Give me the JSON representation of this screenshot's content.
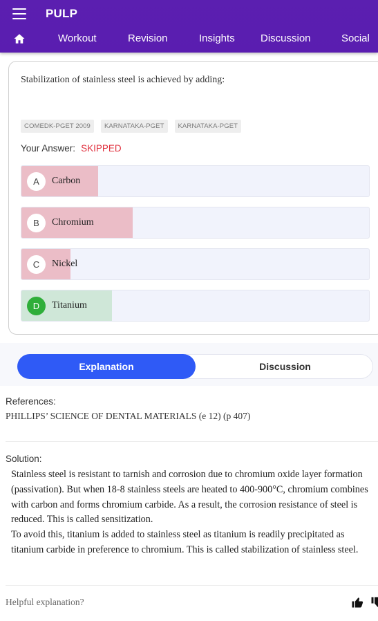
{
  "app": {
    "title": "PULP"
  },
  "nav": {
    "tabs": [
      {
        "label": "Workout"
      },
      {
        "label": "Revision"
      },
      {
        "label": "Insights"
      },
      {
        "label": "Discussion"
      },
      {
        "label": "Social"
      }
    ]
  },
  "question": {
    "text": "Stabilization of stainless steel is achieved by adding:",
    "tags": [
      "COMEDK-PGET 2009",
      "KARNATAKA-PGET",
      "KARNATAKA-PGET"
    ],
    "answer_label": "Your Answer:",
    "answer_status": "SKIPPED",
    "options": [
      {
        "letter": "A",
        "label": "Carbon",
        "correct": false
      },
      {
        "letter": "B",
        "label": "Chromium",
        "correct": false
      },
      {
        "letter": "C",
        "label": "Nickel",
        "correct": false
      },
      {
        "letter": "D",
        "label": "Titanium",
        "correct": true
      }
    ]
  },
  "explanation_tabs": {
    "explanation": "Explanation",
    "discussion": "Discussion"
  },
  "references": {
    "heading": "References:",
    "text": "PHILLIPS’ SCIENCE OF DENTAL MATERIALS (e 12) (p 407)"
  },
  "solution": {
    "heading": "Solution:",
    "paragraphs": [
      "Stainless steel is resistant to tarnish and corrosion due to chromium oxide layer formation (passivation). But when 18-8 stainless steels are heated to 400-900°C, chromium combines with carbon and forms chromium carbide. As a result, the corrosion resistance of steel is reduced. This is called sensitization.",
      "To avoid this, titanium is added to stainless steel as titanium is readily precipitated as titanium carbide in preference to chromium. This is called stabilization of stainless steel."
    ]
  },
  "feedback": {
    "prompt": "Helpful explanation?"
  },
  "colors": {
    "appbar": "#5a1db0",
    "accent": "#2f5af6",
    "skipped": "#e0303e",
    "wrong_fill": "#ebbdc7",
    "correct_fill": "#cfe7d8",
    "correct_badge": "#2fae3a"
  },
  "icons": [
    "menu-icon",
    "home-icon",
    "thumbs-up-icon",
    "thumbs-down-icon"
  ]
}
